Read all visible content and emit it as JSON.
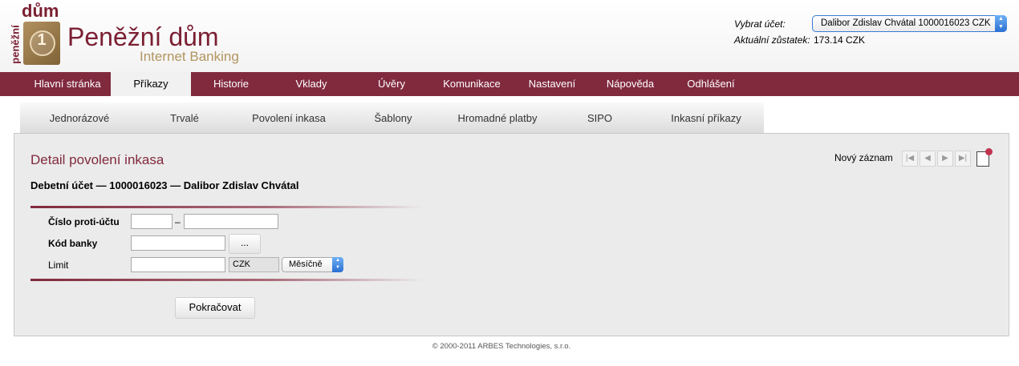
{
  "logo": {
    "vertical_text": "peněžní",
    "top_text": "dům",
    "coin_digit": "1"
  },
  "brand": {
    "title": "Peněžní dům",
    "subtitle": "Internet Banking"
  },
  "account": {
    "select_label": "Vybrat účet:",
    "selected": "Dalibor Zdislav Chvátal 1000016023 CZK",
    "balance_label": "Aktuální zůstatek:",
    "balance_value": "173.14 CZK"
  },
  "main_nav": [
    {
      "label": "Hlavní stránka",
      "active": false
    },
    {
      "label": "Příkazy",
      "active": true
    },
    {
      "label": "Historie",
      "active": false
    },
    {
      "label": "Vklady",
      "active": false
    },
    {
      "label": "Úvěry",
      "active": false
    },
    {
      "label": "Komunikace",
      "active": false
    },
    {
      "label": "Nastavení",
      "active": false
    },
    {
      "label": "Nápověda",
      "active": false
    },
    {
      "label": "Odhlášení",
      "active": false
    }
  ],
  "sub_nav": [
    {
      "label": "Jednorázové",
      "active": false
    },
    {
      "label": "Trvalé",
      "active": false
    },
    {
      "label": "Povolení inkasa",
      "active": true
    },
    {
      "label": "Šablony",
      "active": false
    },
    {
      "label": "Hromadné platby",
      "active": false
    },
    {
      "label": "SIPO",
      "active": false
    },
    {
      "label": "Inkasní příkazy",
      "active": false
    }
  ],
  "detail": {
    "title": "Detail povolení inkasa",
    "new_record": "Nový záznam",
    "account_heading": "Debetní účet — 1000016023 — Dalibor Zdislav Chvátal"
  },
  "form": {
    "counter_account_label": "Číslo proti-účtu",
    "counter_account_prefix": "",
    "counter_account_number": "",
    "dash": "–",
    "bank_code_label": "Kód banky",
    "bank_code_value": "",
    "bank_lookup_label": "...",
    "limit_label": "Limit",
    "limit_value": "",
    "currency": "CZK",
    "period": "Měsíčně",
    "continue_label": "Pokračovat"
  },
  "footer": {
    "copyright": "© 2000-2011 ARBES Technologies, s.r.o."
  }
}
